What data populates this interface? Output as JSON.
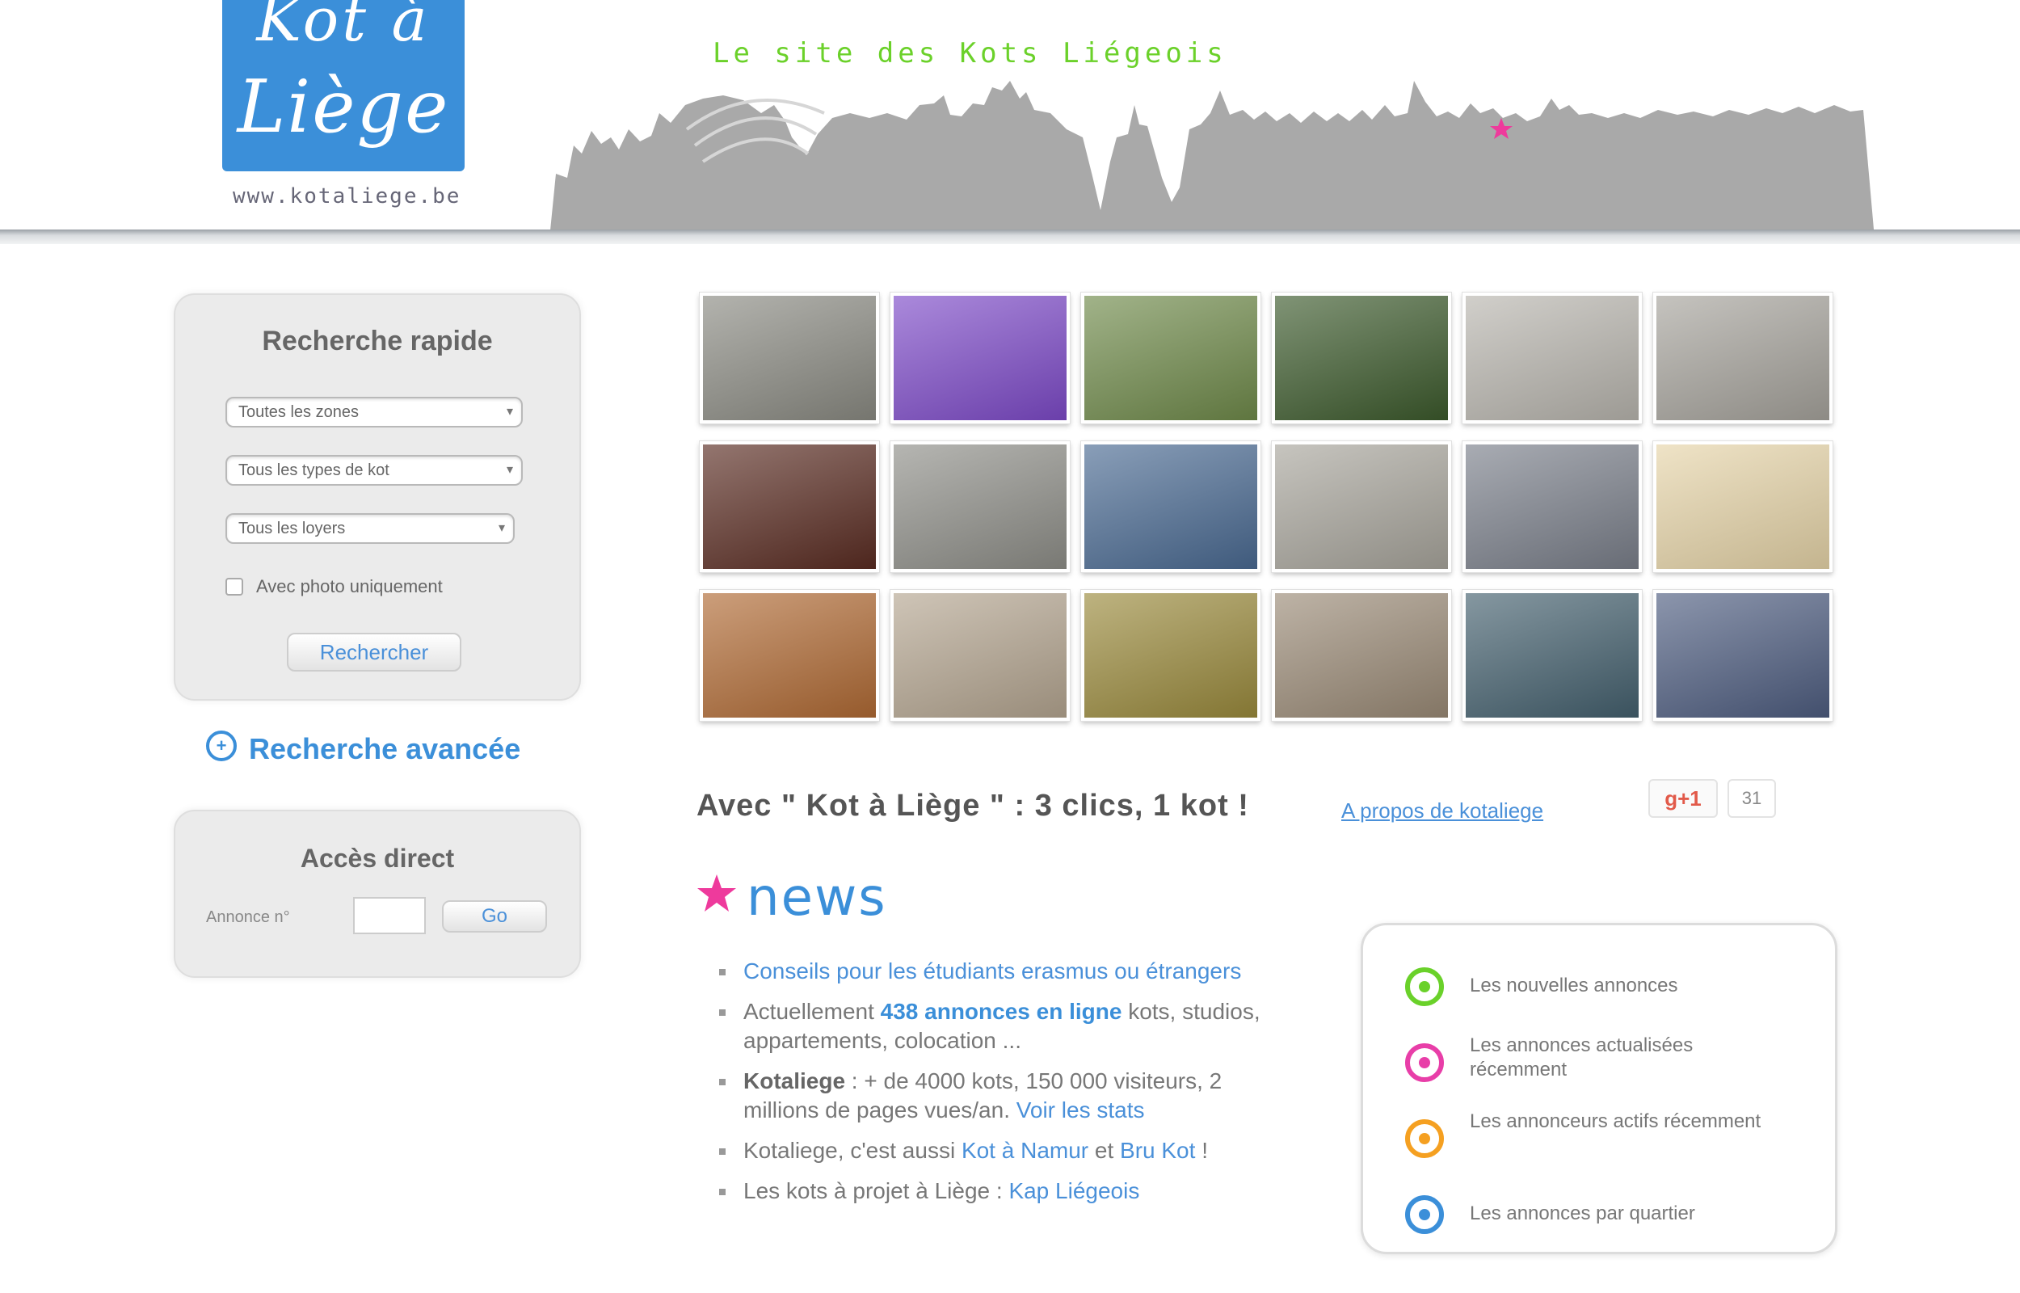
{
  "header": {
    "logo_line1": "Kot à",
    "logo_line2": "Liège",
    "logo_url": "www.kotaliege.be",
    "tagline": "Le site des Kots Liégeois"
  },
  "quick_search": {
    "title": "Recherche rapide",
    "select_zones": "Toutes les zones",
    "select_types": "Tous les types de kot",
    "select_prices": "Tous les loyers",
    "checkbox_label": "Avec photo uniquement",
    "button": "Rechercher"
  },
  "advanced_search": {
    "label": "Recherche avancée"
  },
  "direct_access": {
    "title": "Accès direct",
    "label": "Annonce n°",
    "button": "Go"
  },
  "photos": {
    "colors": [
      [
        "#8a8a82",
        "#7d4ac8",
        "#6f8a4a",
        "#3c5a2c",
        "#b8b5ae",
        "#a6a39c"
      ],
      [
        "#5a2c22",
        "#8e8e88",
        "#4a6a92",
        "#a8a59c",
        "#7a7f8a",
        "#e6d4a8"
      ],
      [
        "#b06a34",
        "#b4a590",
        "#9a8a3c",
        "#9a8a76",
        "#44606e",
        "#4e5d80"
      ]
    ]
  },
  "promo": {
    "slogan": "Avec \" Kot à Liège \" : 3 clics, 1 kot !",
    "about_link": "A propos de kotaliege",
    "gplus": "g+1",
    "counter": "31"
  },
  "news": {
    "title": "news",
    "items": [
      {
        "link": "Conseils pour les étudiants erasmus ou étrangers"
      },
      {
        "pre": "Actuellement ",
        "link": "438 annonces en ligne",
        "post": " kots, studios, appartements, colocation ..."
      },
      {
        "pre": "Kotaliege",
        "post": " : + de 4000 kots, 150 000 visiteurs, 2 millions de pages vues/an. ",
        "link": "Voir les stats"
      },
      {
        "pre": "Kotaliege, c'est aussi ",
        "link": "Kot à Namur",
        "mid": " et ",
        "link2": "Bru Kot",
        "post": " !"
      },
      {
        "pre": "Les kots à projet à Liège : ",
        "link": "Kap Liégeois"
      }
    ]
  },
  "legend": {
    "items": [
      {
        "text": "Les nouvelles annonces",
        "color": "#6ad12a"
      },
      {
        "text": "Les annonces actualisées récemment",
        "color": "#e83ea8"
      },
      {
        "text": "Les annonceurs actifs récemment",
        "color": "#f5a021"
      },
      {
        "text": "Les annonces par quartier",
        "color": "#3b8fd9"
      }
    ]
  }
}
